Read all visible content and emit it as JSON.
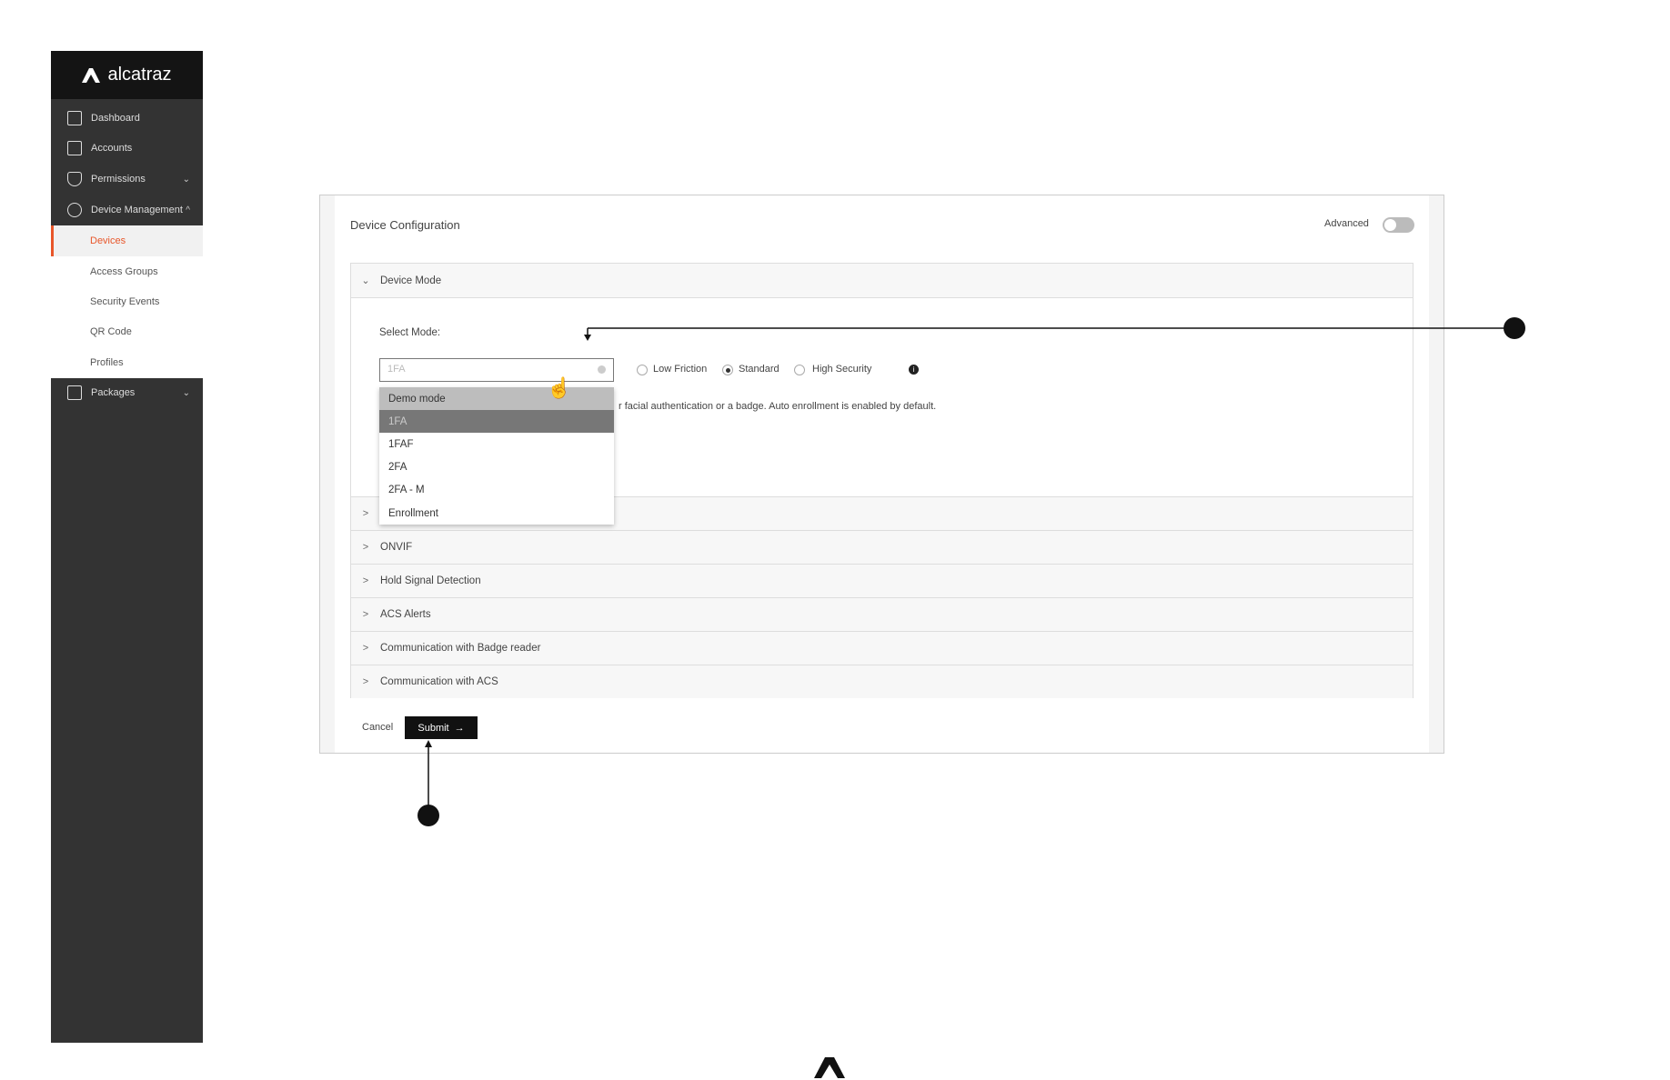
{
  "brand": {
    "name": "alcatraz"
  },
  "sidebar": {
    "items": [
      {
        "label": "Dashboard",
        "icon": "bar-chart-icon"
      },
      {
        "label": "Accounts",
        "icon": "account-icon"
      },
      {
        "label": "Permissions",
        "icon": "shield-check-icon",
        "chevron": "down"
      },
      {
        "label": "Device Management",
        "icon": "gear-icon",
        "chevron": "up"
      },
      {
        "label": "Packages",
        "icon": "package-icon",
        "chevron": "down"
      }
    ],
    "sub_items": [
      "Devices",
      "Access Groups",
      "Security Events",
      "QR Code",
      "Profiles"
    ],
    "active_sub": "Devices"
  },
  "card": {
    "title": "Device Configuration",
    "advanced_label": "Advanced",
    "advanced_on": false
  },
  "device_mode": {
    "header": "Device Mode",
    "select_label": "Select Mode:",
    "select_value": "1FA",
    "options": [
      "Demo mode",
      "1FA",
      "1FAF",
      "2FA",
      "2FA - M",
      "Enrollment"
    ],
    "highlighted": "1FA",
    "radios": [
      {
        "label": "Low Friction",
        "checked": false
      },
      {
        "label": "Standard",
        "checked": true
      },
      {
        "label": "High Security",
        "checked": false
      }
    ],
    "description": "r facial authentication or a badge. Auto enrollment is enabled by default."
  },
  "sections": [
    "ONVIF",
    "Hold Signal Detection",
    "ACS Alerts",
    "Communication with Badge reader",
    "Communication with ACS"
  ],
  "actions": {
    "cancel": "Cancel",
    "submit": "Submit"
  },
  "colors": {
    "accent": "#e8562a",
    "sidebar": "#333333"
  }
}
